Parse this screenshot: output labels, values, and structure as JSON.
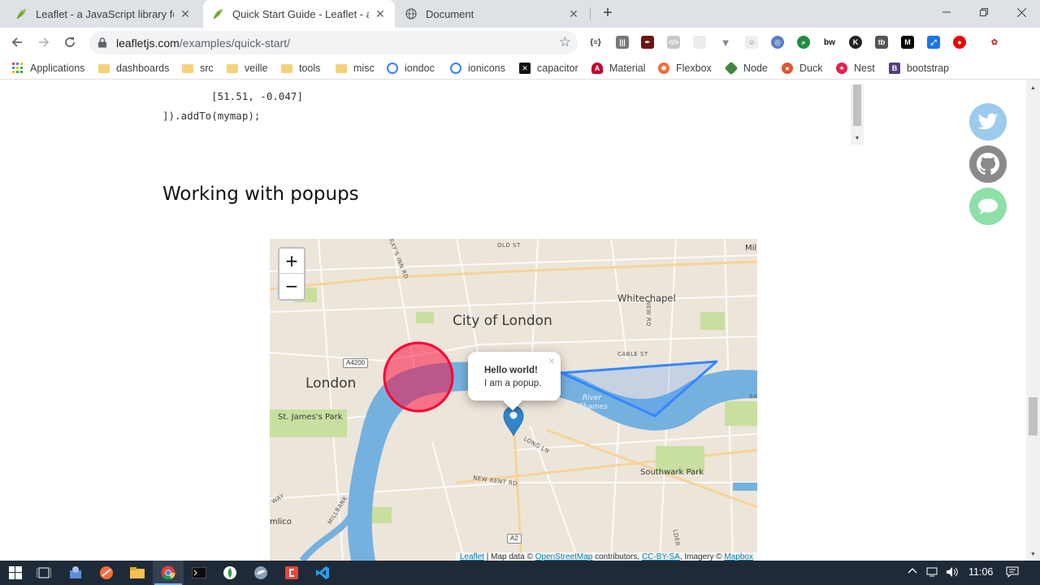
{
  "browser": {
    "tabs": [
      {
        "title": "Leaflet - a JavaScript library for interactive maps",
        "icon": "leaf-icon",
        "active": false
      },
      {
        "title": "Quick Start Guide - Leaflet - a JavaScript library",
        "icon": "leaf-icon",
        "active": true
      },
      {
        "title": "Document",
        "icon": "globe-icon",
        "active": false
      }
    ],
    "new_tab_label": "+",
    "url_host": "leafletjs.com",
    "url_path": "/examples/quick-start/"
  },
  "bookmarks": [
    {
      "label": "Applications",
      "icon": "apps-grid-icon"
    },
    {
      "label": "dashboards",
      "icon": "folder-icon"
    },
    {
      "label": "src",
      "icon": "folder-icon"
    },
    {
      "label": "veille",
      "icon": "folder-icon"
    },
    {
      "label": "tools",
      "icon": "folder-icon"
    },
    {
      "label": "misc",
      "icon": "folder-icon"
    },
    {
      "label": "iondoc",
      "icon": "ionic-icon"
    },
    {
      "label": "ionicons",
      "icon": "ionic-icon"
    },
    {
      "label": "capacitor",
      "icon": "capacitor-icon"
    },
    {
      "label": "Material",
      "icon": "angular-icon"
    },
    {
      "label": "Flexbox",
      "icon": "flexbox-icon"
    },
    {
      "label": "Node",
      "icon": "node-icon"
    },
    {
      "label": "Duck",
      "icon": "duckduckgo-icon"
    },
    {
      "label": "Nest",
      "icon": "nest-icon"
    },
    {
      "label": "bootstrap",
      "icon": "bootstrap-icon"
    }
  ],
  "page": {
    "code_line_1": "    [51.51, -0.047]",
    "code_line_2": "]).addTo(mymap);",
    "section_heading": "Working with popups"
  },
  "map": {
    "zoom_in": "+",
    "zoom_out": "−",
    "popup_title": "Hello world!",
    "popup_text": "I am a popup.",
    "popup_close": "×",
    "labels": {
      "city_of_london": "City of London",
      "london": "London",
      "whitechapel": "Whitechapel",
      "st_james_park": "St. James's Park",
      "river_thames_1": "River",
      "river_thames_2": "Thames",
      "southwark_park": "Southwark Park",
      "old_st": "OLD ST",
      "cable_st": "CABLE ST",
      "new_kent_rd": "NEW KENT RD",
      "long_ln": "LONG LN",
      "millbank": "MILLBANK",
      "grays_inn_rd": "GRAY'S INN RD",
      "new_rd": "NEW RD",
      "mile": "Mil",
      "way": "WAY",
      "mlico": "mlico",
      "sa": "SA",
      "lder": "LDER",
      "a4200": "A4200",
      "a2": "A2"
    },
    "attribution": {
      "leaflet": "Leaflet",
      "sep": " | Map data © ",
      "osm": "OpenStreetMap",
      "contrib": " contributors, ",
      "license": "CC-BY-SA",
      "imagery": ", Imagery © ",
      "mapbox": "Mapbox"
    }
  },
  "taskbar": {
    "clock": "11:06"
  },
  "colors": {
    "twitter": "#9ccbed",
    "github": "#8a8a8a",
    "chat": "#8ee0a8",
    "circle": "#f03",
    "polygon": "#3388ff",
    "water": "#74b2e0"
  }
}
